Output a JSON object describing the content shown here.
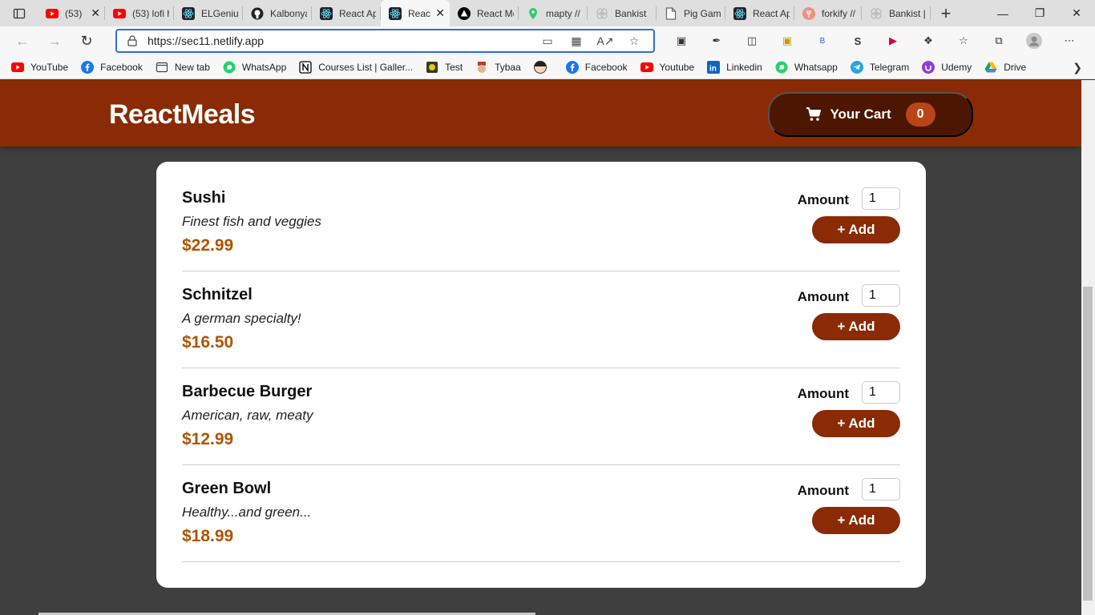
{
  "browser": {
    "tabs": [
      {
        "title": "(53)",
        "icon": "youtube-icon",
        "color": "#ff0000",
        "closable": true
      },
      {
        "title": "(53) lofi h",
        "icon": "youtube-icon",
        "color": "#ff0000"
      },
      {
        "title": "ELGenius",
        "icon": "react-icon",
        "color": "#61dafb"
      },
      {
        "title": "Kalbonya",
        "icon": "github-icon",
        "color": "#222222"
      },
      {
        "title": "React Ap",
        "icon": "react-icon",
        "color": "#61dafb"
      },
      {
        "title": "Reac",
        "icon": "react-icon",
        "color": "#61dafb",
        "active": true,
        "closable": true
      },
      {
        "title": "React Me",
        "icon": "triangle-icon",
        "color": "#000000"
      },
      {
        "title": "mapty //",
        "icon": "map-pin-icon",
        "color": "#2ecc71"
      },
      {
        "title": "Bankist",
        "icon": "bankist-icon",
        "color": "#cccccc"
      },
      {
        "title": "Pig Gam",
        "icon": "page-icon",
        "color": "#666666"
      },
      {
        "title": "React Ap",
        "icon": "react-icon",
        "color": "#61dafb"
      },
      {
        "title": "forkify //",
        "icon": "forkify-icon",
        "color": "#f38e82"
      },
      {
        "title": "Bankist |",
        "icon": "bankist-icon",
        "color": "#cccccc"
      }
    ],
    "url": "https://sec11.netlify.app",
    "bookmarks": [
      {
        "label": "YouTube",
        "icon": "youtube-icon",
        "color": "#ff0000"
      },
      {
        "label": "Facebook",
        "icon": "facebook-icon",
        "color": "#1877f2"
      },
      {
        "label": "New tab",
        "icon": "new-tab-icon",
        "color": "#444444"
      },
      {
        "label": "WhatsApp",
        "icon": "whatsapp-icon",
        "color": "#25d366"
      },
      {
        "label": "Courses List | Galler...",
        "icon": "notion-icon",
        "color": "#000000"
      },
      {
        "label": "Test",
        "icon": "test-icon",
        "color": "#333333"
      },
      {
        "label": "Tybaa",
        "icon": "tybaa-icon",
        "color": "#c0392b"
      },
      {
        "label": "",
        "icon": "avatar-icon",
        "color": "#333333"
      },
      {
        "label": "Facebook",
        "icon": "facebook-icon",
        "color": "#1877f2"
      },
      {
        "label": "Youtube",
        "icon": "youtube-icon",
        "color": "#ff0000"
      },
      {
        "label": "Linkedin",
        "icon": "linkedin-icon",
        "color": "#0a66c2"
      },
      {
        "label": "Whatsapp",
        "icon": "whatsapp-icon",
        "color": "#25d366"
      },
      {
        "label": "Telegram",
        "icon": "telegram-icon",
        "color": "#2aa3df"
      },
      {
        "label": "Udemy",
        "icon": "udemy-icon",
        "color": "#8b3fd9"
      },
      {
        "label": "Drive",
        "icon": "drive-icon",
        "color": "#1fa463"
      }
    ]
  },
  "app": {
    "brand": "ReactMeals",
    "cart_label": "Your Cart",
    "cart_count": "0",
    "meals": [
      {
        "name": "Sushi",
        "description": "Finest fish and veggies",
        "price": "$22.99",
        "amount_label": "Amount",
        "amount": "1",
        "add_label": "+ Add"
      },
      {
        "name": "Schnitzel",
        "description": "A german specialty!",
        "price": "$16.50",
        "amount_label": "Amount",
        "amount": "1",
        "add_label": "+ Add"
      },
      {
        "name": "Barbecue Burger",
        "description": "American, raw, meaty",
        "price": "$12.99",
        "amount_label": "Amount",
        "amount": "1",
        "add_label": "+ Add"
      },
      {
        "name": "Green Bowl",
        "description": "Healthy...and green...",
        "price": "$18.99",
        "amount_label": "Amount",
        "amount": "1",
        "add_label": "+ Add"
      }
    ]
  },
  "colors": {
    "header": "#8a2b06",
    "cart_button": "#4d1601",
    "badge": "#b94517",
    "price": "#ad5502",
    "background": "#3f3f3f"
  }
}
